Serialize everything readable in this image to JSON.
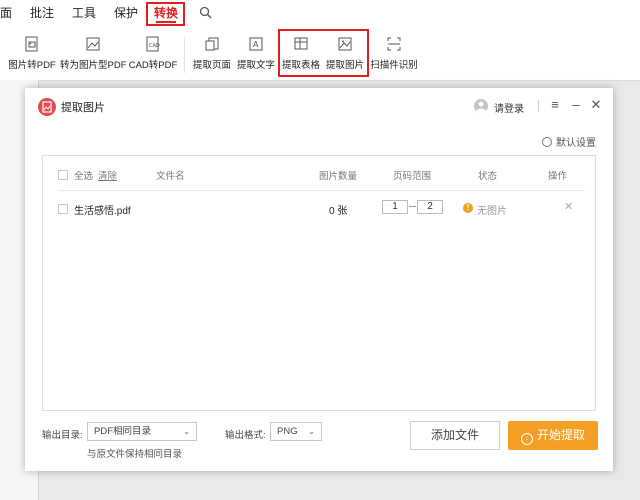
{
  "menubar": {
    "items": [
      "面",
      "批注",
      "工具",
      "保护",
      "转换"
    ],
    "search_icon": "search-icon"
  },
  "ribbon": {
    "group1": [
      "图片转PDF",
      "转为图片型PDF",
      "CAD转PDF"
    ],
    "group2": [
      "提取页面",
      "提取文字",
      "提取表格",
      "提取图片",
      "扫描件识别"
    ]
  },
  "dialog": {
    "title": "提取图片",
    "login": "请登录",
    "settings": "默认设置",
    "table": {
      "select_all": "全选",
      "clear": "清除",
      "headers": {
        "filename": "文件名",
        "image_count": "图片数量",
        "page_range": "页码范围",
        "status": "状态",
        "action": "操作"
      },
      "rows": [
        {
          "filename": "生活感悟.pdf",
          "image_count": "0 张",
          "page_from": "1",
          "page_to": "2",
          "status": "无图片"
        }
      ]
    },
    "footer": {
      "output_dir_label": "输出目录:",
      "output_dir_value": "PDF相同目录",
      "output_dir_note": "与原文件保持相同目录",
      "format_label": "输出格式:",
      "format_value": "PNG",
      "add_file": "添加文件",
      "start": "开始提取"
    }
  },
  "colors": {
    "accent_red": "#e02020",
    "start_button": "#f5a025",
    "warning": "#f0a020"
  }
}
